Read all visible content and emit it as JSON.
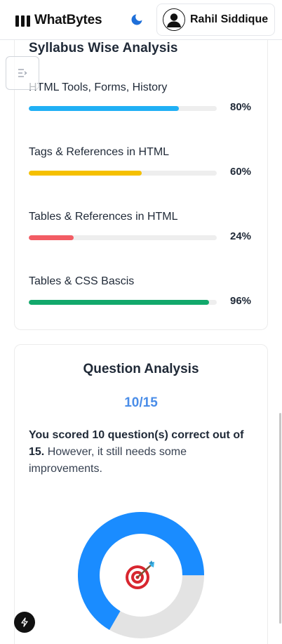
{
  "header": {
    "brand": "WhatBytes",
    "user_name": "Rahil Siddique",
    "theme_icon": "moon-icon",
    "accent": "#1e6fd9"
  },
  "syllabus": {
    "title": "Syllabus Wise Analysis",
    "topics": [
      {
        "label": "HTML Tools, Forms, History",
        "percent_text": "80%",
        "value": 80,
        "color": "#20b0f5"
      },
      {
        "label": "Tags & References in HTML",
        "percent_text": "60%",
        "value": 60,
        "color": "#f5c000"
      },
      {
        "label": "Tables & References in HTML",
        "percent_text": "24%",
        "value": 24,
        "color": "#f25c64"
      },
      {
        "label": "Tables & CSS Bascis",
        "percent_text": "96%",
        "value": 96,
        "color": "#12a86b"
      }
    ]
  },
  "question_analysis": {
    "title": "Question Analysis",
    "score_text": "10/15",
    "correct": 10,
    "total": 15,
    "summary_bold": "You scored 10 question(s) correct out of 15.",
    "summary_rest": " However, it still needs some improvements.",
    "donut_color_correct": "#1a8cff",
    "donut_color_remaining": "#e3e3e3",
    "center_icon": "target-icon"
  }
}
